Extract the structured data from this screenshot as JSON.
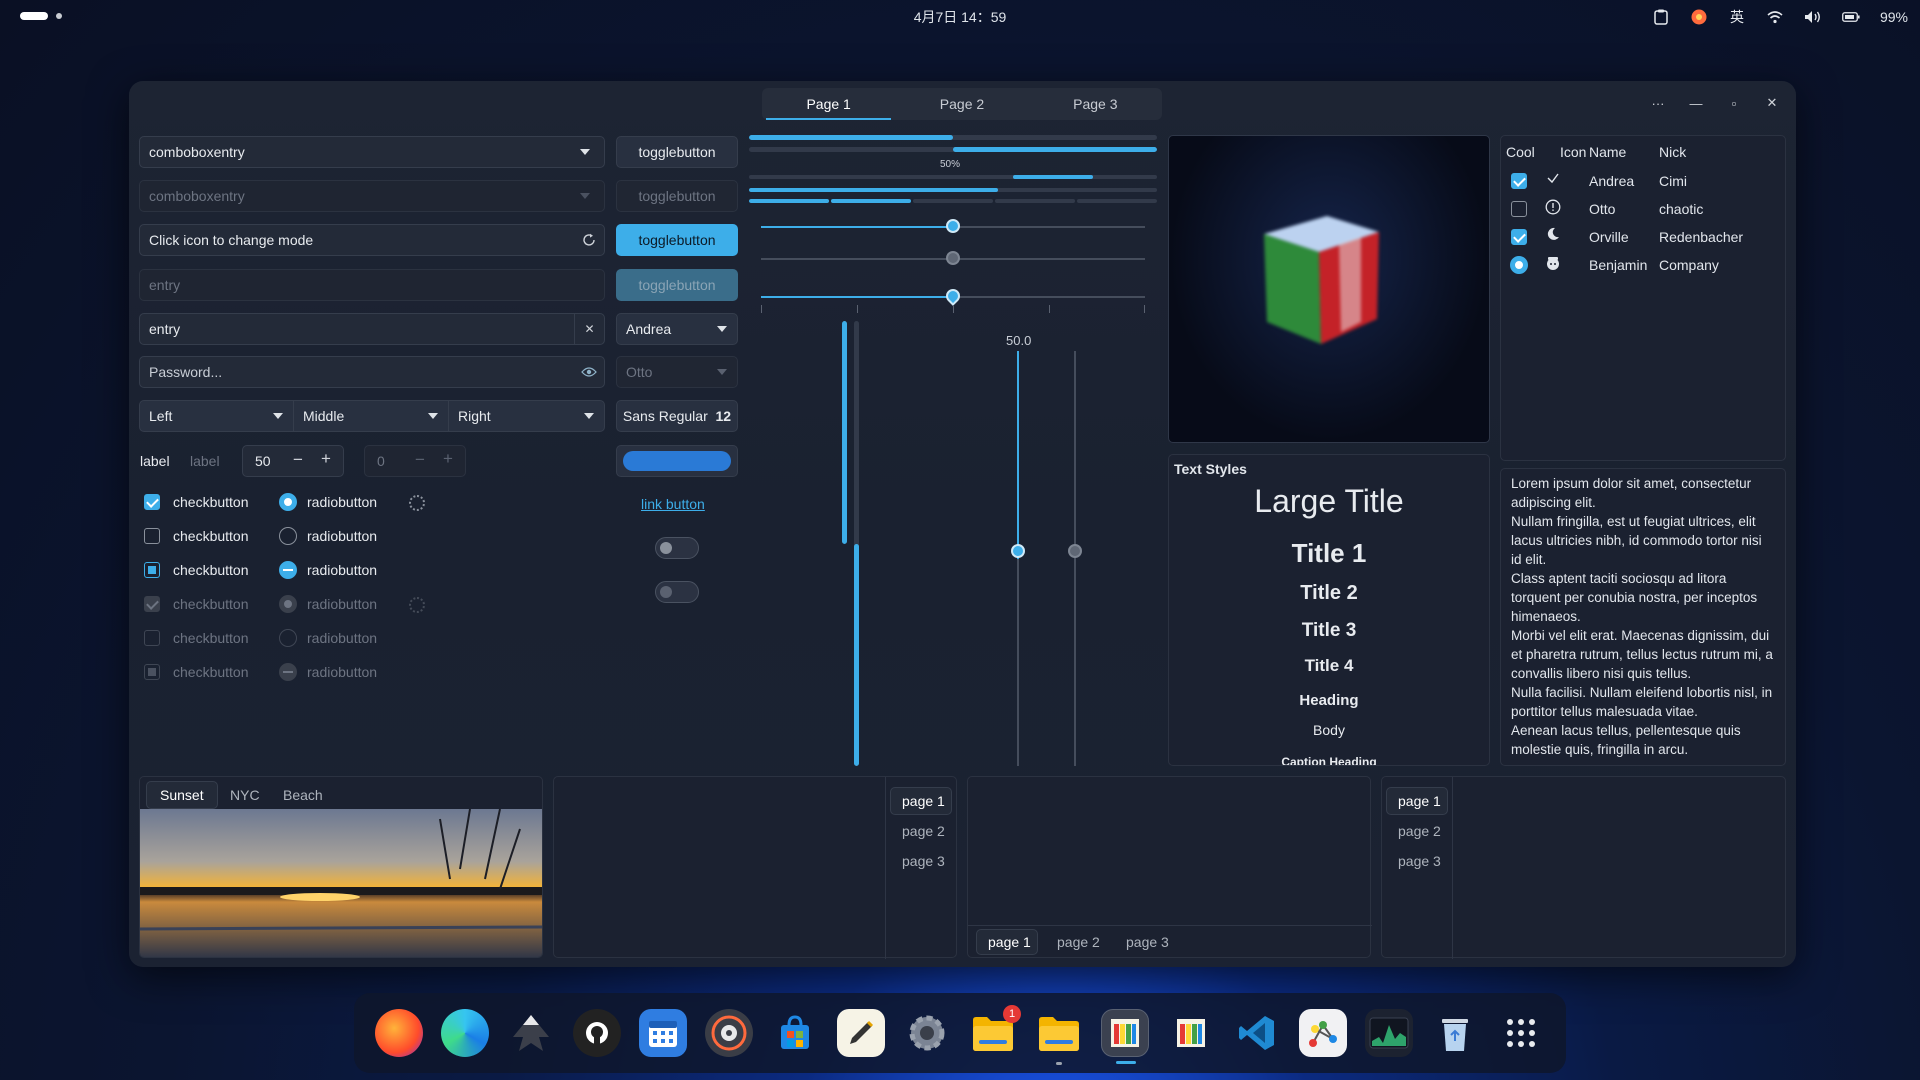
{
  "topbar": {
    "datetime": "4月7日 14：59",
    "ime": "英",
    "battery": "99%",
    "icons": [
      "clipboard-icon",
      "notification-app-icon",
      "ime-icon",
      "wifi-icon",
      "volume-icon",
      "battery-icon"
    ]
  },
  "window": {
    "tabs": [
      "Page 1",
      "Page 2",
      "Page 3"
    ],
    "controls": [
      "more-icon",
      "minimize-icon",
      "maximize-icon",
      "close-icon"
    ]
  },
  "left": {
    "combo_entry": "comboboxentry",
    "combo_entry_dim": "comboboxentry",
    "mode_entry": "Click icon to change mode",
    "entry_dim_placeholder": "entry",
    "entry_value": "entry",
    "password_placeholder": "Password...",
    "combo_left": "Left",
    "combo_middle": "Middle",
    "combo_right": "Right",
    "label1": "label",
    "label2": "label",
    "spin_value": "50",
    "spin_dim_value": "0",
    "check_label": "checkbutton",
    "radio_label": "radiobutton",
    "minus": "−",
    "plus": "+"
  },
  "buttons": {
    "toggle1": "togglebutton",
    "toggle2": "togglebutton",
    "toggle3": "togglebutton",
    "toggle4": "togglebutton",
    "combo_andrea": "Andrea",
    "combo_otto": "Otto",
    "font_name": "Sans Regular",
    "font_size": "12",
    "link": "link button"
  },
  "sliders": {
    "progress_label": "50%",
    "scale_value": "50.0"
  },
  "text_styles": {
    "header": "Text Styles",
    "large_title": "Large Title",
    "title1": "Title 1",
    "title2": "Title 2",
    "title3": "Title 3",
    "title4": "Title 4",
    "heading": "Heading",
    "body": "Body",
    "caption_heading": "Caption Heading"
  },
  "tree": {
    "columns": [
      "Cool",
      "Icon",
      "Name",
      "Nick"
    ],
    "rows": [
      {
        "name": "Andrea",
        "nick": "Cimi",
        "icon": "check-icon",
        "cool": "checked"
      },
      {
        "name": "Otto",
        "nick": "chaotic",
        "icon": "warning-icon",
        "cool": "unchecked"
      },
      {
        "name": "Orville",
        "nick": "Redenbacher",
        "icon": "moon-icon",
        "cool": "checked"
      },
      {
        "name": "Benjamin",
        "nick": "Company",
        "icon": "face-icon",
        "cool": "radio"
      }
    ]
  },
  "lorem": [
    "Lorem ipsum dolor sit amet, consectetur adipiscing elit.",
    "Nullam fringilla, est ut feugiat ultrices, elit lacus ultricies nibh, id commodo tortor nisi id elit.",
    "Class aptent taciti sociosqu ad litora torquent per conubia nostra, per inceptos himenaeos.",
    "Morbi vel elit erat. Maecenas dignissim, dui et pharetra rutrum, tellus lectus rutrum mi, a convallis libero nisi quis tellus.",
    "Nulla facilisi. Nullam eleifend lobortis nisl, in porttitor tellus malesuada vitae.",
    "Aenean lacus tellus, pellentesque quis molestie quis, fringilla in arcu."
  ],
  "photo_tabs": [
    "Sunset",
    "NYC",
    "Beach"
  ],
  "notebook_pages": [
    "page 1",
    "page 2",
    "page 3"
  ],
  "dock": [
    {
      "name": "firefox",
      "icon": "firefox-icon"
    },
    {
      "name": "edge",
      "icon": "edge-icon"
    },
    {
      "name": "inkscape",
      "icon": "inkscape-icon"
    },
    {
      "name": "github",
      "icon": "github-icon"
    },
    {
      "name": "calendar",
      "icon": "calendar-icon"
    },
    {
      "name": "music",
      "icon": "music-icon"
    },
    {
      "name": "store",
      "icon": "store-icon"
    },
    {
      "name": "editor",
      "icon": "editor-icon"
    },
    {
      "name": "settings",
      "icon": "settings-icon"
    },
    {
      "name": "files-badge",
      "icon": "folder-icon",
      "badge": "1"
    },
    {
      "name": "files",
      "icon": "folder-icon"
    },
    {
      "name": "gtk-demo-active",
      "icon": "palette-icon"
    },
    {
      "name": "gtk-demo",
      "icon": "palette-icon"
    },
    {
      "name": "vscode",
      "icon": "vscode-icon"
    },
    {
      "name": "graph",
      "icon": "graph-icon"
    },
    {
      "name": "monitor",
      "icon": "system-monitor-icon"
    },
    {
      "name": "trash",
      "icon": "trash-icon"
    },
    {
      "name": "app-grid",
      "icon": "app-grid-icon"
    }
  ]
}
